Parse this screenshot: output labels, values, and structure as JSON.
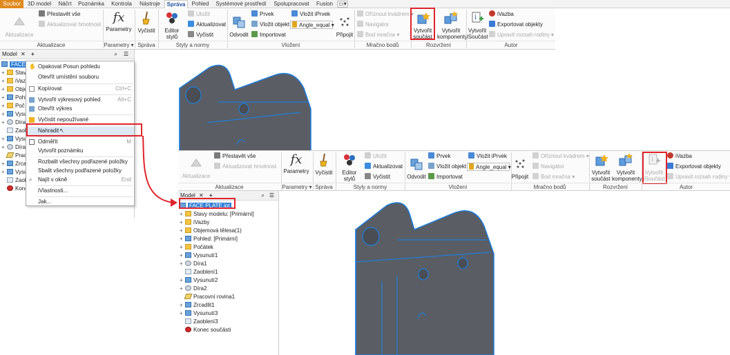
{
  "colors": {
    "file_tab": "#e08a1e",
    "highlight_box": "#e0232a",
    "selection": "#2f7fd6",
    "edge_blue": "#1e7fe0"
  },
  "tabs": [
    "Soubor",
    "3D model",
    "Náčrt",
    "Poznámka",
    "Kontrola",
    "Nástroje",
    "Správa",
    "Pohled",
    "Systémové prostředí",
    "Spolupracovat",
    "Fusion"
  ],
  "ribbon_top": {
    "aktualizace": {
      "big": "Aktualizace",
      "prestavet": "Přestavět vše",
      "aktual_hmot": "Aktualizovat hmotnost",
      "group": "Aktualizace"
    },
    "parametry": {
      "big": "Parametry",
      "group": "Parametry"
    },
    "sprava": {
      "big": "Vyčistit",
      "group": "Správa"
    },
    "styly": {
      "editor": "Editor stylů",
      "ulozit": "Uložit",
      "aktualizovat": "Aktualizovat",
      "vycistit": "Vyčistit",
      "group": "Styly a normy"
    },
    "vlozeni": {
      "odvodit": "Odvodit",
      "prvek": "Prvek",
      "vlozit_objekt": "Vložit objekt",
      "importovat": "Importovat",
      "vlozit_iprvek": "Vložit iPrvek",
      "angle": "Angle_equal",
      "pripojit": "Připojit",
      "group": "Vložení"
    },
    "mracno": {
      "oriznout": "Oříznout kvádrem",
      "navigator": "Navigátor",
      "bod_mracna": "Bod mračna",
      "group": "Mračno bodů"
    },
    "rozvrzeni": {
      "vytvorit_soucast_1": "Vytvořit",
      "vytvorit_soucast_2": "součást",
      "vytvorit_komp_1": "Vytvořit",
      "vytvorit_komp_2": "komponenty",
      "group": "Rozvržení"
    },
    "autor": {
      "vytvorit_isoucast_1": "Vytvořit",
      "vytvorit_isoucast_2": "iSoučást",
      "ivazba": "iVazba",
      "exportovat": "Exportovat objekty",
      "upravit": "Upravit rozsah rodiny",
      "group": "Autor"
    }
  },
  "browser1": {
    "tab_model": "Model",
    "items": [
      "FACE P",
      "Stav",
      "iVazb",
      "Obje",
      "Pohl",
      "Poč",
      "Vysu",
      "Díra",
      "Zaob",
      "Vysu",
      "Díra",
      "Prac",
      "Zrca",
      "Vysu",
      "Zaob",
      "Konec"
    ]
  },
  "context_menu": {
    "items": [
      {
        "label": "Opakovat Posun pohledu",
        "shortcut": ""
      },
      {
        "label": "Otevřít umístění souboru",
        "shortcut": ""
      },
      {
        "label": "Kopírovat",
        "shortcut": "Ctrl+C"
      },
      {
        "label": "Vytvořit výkresový pohled",
        "shortcut": "Alt+C"
      },
      {
        "label": "Otevřít výkres",
        "shortcut": ""
      },
      {
        "label": "Vyčistit nepoužívané",
        "shortcut": ""
      },
      {
        "label": "Nahradit",
        "shortcut": ""
      },
      {
        "label": "Odměřit",
        "shortcut": "M"
      },
      {
        "label": "Vytvořit poznámku",
        "shortcut": ""
      },
      {
        "label": "Rozbalit všechny podřazené položky",
        "shortcut": ""
      },
      {
        "label": "Sbalit všechny podřazené položky",
        "shortcut": ""
      },
      {
        "label": "Najít v okně",
        "shortcut": "End"
      },
      {
        "label": "iVlastnosti...",
        "shortcut": ""
      },
      {
        "label": "Jak...",
        "shortcut": ""
      }
    ]
  },
  "ribbon_bottom": {
    "aktualizace": {
      "big": "Aktualizace",
      "prestavet": "Přestavět vše",
      "aktual_hmot": "Aktualizovat hmotnost",
      "group": "Aktualizace"
    },
    "parametry": {
      "big": "Parametry",
      "group": "Parametry"
    },
    "sprava": {
      "big": "Vyčistit",
      "group": "Správa"
    },
    "styly": {
      "editor": "Editor stylů",
      "ulozit": "Uložit",
      "aktualizovat": "Aktualizovat",
      "vycistit": "Vyčistit",
      "group": "Styly a normy"
    },
    "vlozeni": {
      "odvodit": "Odvodit",
      "prvek": "Prvek",
      "vlozit_objekt": "Vložit objekt",
      "importovat": "Importovat",
      "vlozit_iprvek": "Vložit iPrvek",
      "angle": "Angle_equal",
      "group": "Vložení"
    },
    "mracno": {
      "pripojit": "Připojit",
      "oriznout": "Oříznout kvádrem",
      "navigator": "Navigátor",
      "bod_mracna": "Bod mračna",
      "group": "Mračno bodů"
    },
    "rozvrzeni": {
      "vytvorit_soucast_1": "Vytvořit",
      "vytvorit_soucast_2": "součást",
      "vytvorit_komp_1": "Vytvořit",
      "vytvorit_komp_2": "komponenty",
      "group": "Rozvržení"
    },
    "autor": {
      "vytvorit_isoucast_1": "Vytvořit",
      "vytvorit_isoucast_2": "iSoučást",
      "ivazba": "iVazba",
      "exportovat": "Exportovat objekty",
      "upravit": "Upravit rozsah rodiny",
      "group": "Autor"
    }
  },
  "browser2": {
    "tab_model": "Model",
    "items": [
      "FACE PLATE.ipt",
      "Stavy modelu: [Primární]",
      "iVazby",
      "Objemová tělesa(1)",
      "Pohled: [Primární]",
      "Počátek",
      "Vysunutí1",
      "Díra1",
      "Zaoblení1",
      "Vysunutí2",
      "Díra2",
      "Pracovní rovina1",
      "Zrcadlit1",
      "Vysunutí3",
      "Zaoblení3",
      "Konec součásti"
    ]
  }
}
